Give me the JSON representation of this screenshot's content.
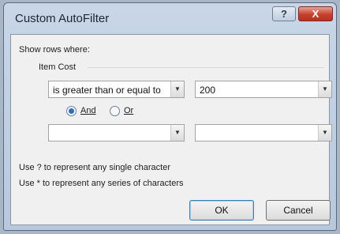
{
  "window": {
    "title": "Custom AutoFilter",
    "help_label": "?",
    "close_label": "X"
  },
  "show_rows_label": "Show rows where:",
  "field_name": "Item Cost",
  "criteria1": {
    "operator": "is greater than or equal to",
    "value": "200"
  },
  "logic": {
    "and_label": "And",
    "or_label": "Or",
    "selected": "And"
  },
  "criteria2": {
    "operator": "",
    "value": ""
  },
  "hints": [
    "Use ? to represent any single character",
    "Use * to represent any series of characters"
  ],
  "buttons": {
    "ok_label": "OK",
    "cancel_label": "Cancel"
  },
  "icons": {
    "dropdown": "chevron-down-icon"
  }
}
